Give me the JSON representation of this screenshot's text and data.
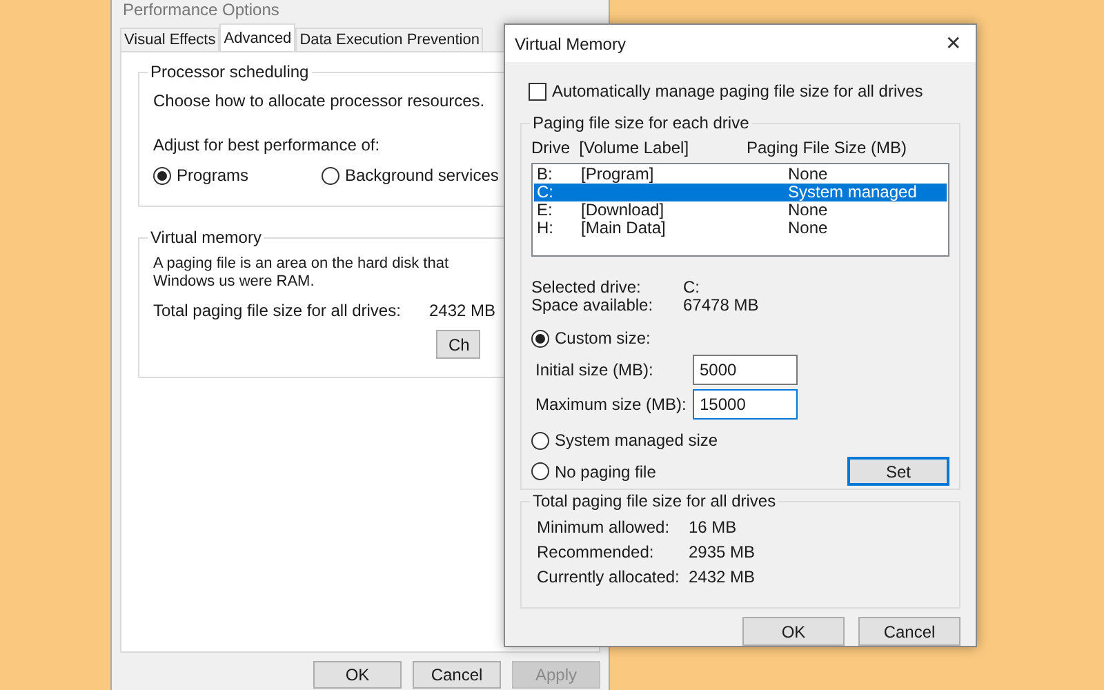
{
  "back_window": {
    "title": "Performance Options",
    "tabs": [
      {
        "label": "Visual Effects",
        "selected": false
      },
      {
        "label": "Advanced",
        "selected": true
      },
      {
        "label": "Data Execution Prevention",
        "selected": false
      }
    ],
    "processor_scheduling": {
      "heading": "Processor scheduling",
      "description": "Choose how to allocate processor resources.",
      "prompt": "Adjust for best performance of:",
      "options": [
        {
          "label": "Programs",
          "selected": true
        },
        {
          "label": "Background services",
          "selected": false
        }
      ]
    },
    "virtual_memory": {
      "heading": "Virtual memory",
      "description": "A paging file is an area on the hard disk that Windows us were RAM.",
      "total_label": "Total paging file size for all drives:",
      "total_value": "2432 MB",
      "button": "Ch"
    },
    "buttons": [
      {
        "label": "OK",
        "disabled": false
      },
      {
        "label": "Cancel",
        "disabled": false
      },
      {
        "label": "Apply",
        "disabled": true
      }
    ]
  },
  "dialog": {
    "title": "Virtual Memory",
    "close": "✕",
    "auto_manage": {
      "label": "Automatically manage paging file size for all drives",
      "checked": false
    },
    "drives_group": {
      "heading": "Paging file size for each drive",
      "columns": [
        "Drive  [Volume Label]",
        "Paging File Size (MB)"
      ],
      "rows": [
        {
          "drive": "B:",
          "label": "[Program]",
          "size": "None",
          "selected": false
        },
        {
          "drive": "C:",
          "label": "",
          "size": "System managed",
          "selected": true
        },
        {
          "drive": "E:",
          "label": "[Download]",
          "size": "None",
          "selected": false
        },
        {
          "drive": "H:",
          "label": "[Main Data]",
          "size": "None",
          "selected": false
        }
      ],
      "info": [
        {
          "label": "Selected drive:",
          "value": "C:"
        },
        {
          "label": "Space available:",
          "value": "67478 MB"
        }
      ],
      "options": [
        {
          "label": "Custom size:",
          "selected": true
        },
        {
          "label": "System managed size",
          "selected": false
        },
        {
          "label": "No paging file",
          "selected": false
        }
      ],
      "fields": [
        {
          "label": "Initial size (MB):",
          "value": "5000",
          "focused": false
        },
        {
          "label": "Maximum size (MB):",
          "value": "15000",
          "focused": true
        }
      ],
      "set_button": "Set"
    },
    "totals_group": {
      "heading": "Total paging file size for all drives",
      "rows": [
        {
          "label": "Minimum allowed:",
          "value": "16 MB"
        },
        {
          "label": "Recommended:",
          "value": "2935 MB"
        },
        {
          "label": "Currently allocated:",
          "value": "2432 MB"
        }
      ]
    },
    "buttons": [
      "OK",
      "Cancel"
    ]
  }
}
